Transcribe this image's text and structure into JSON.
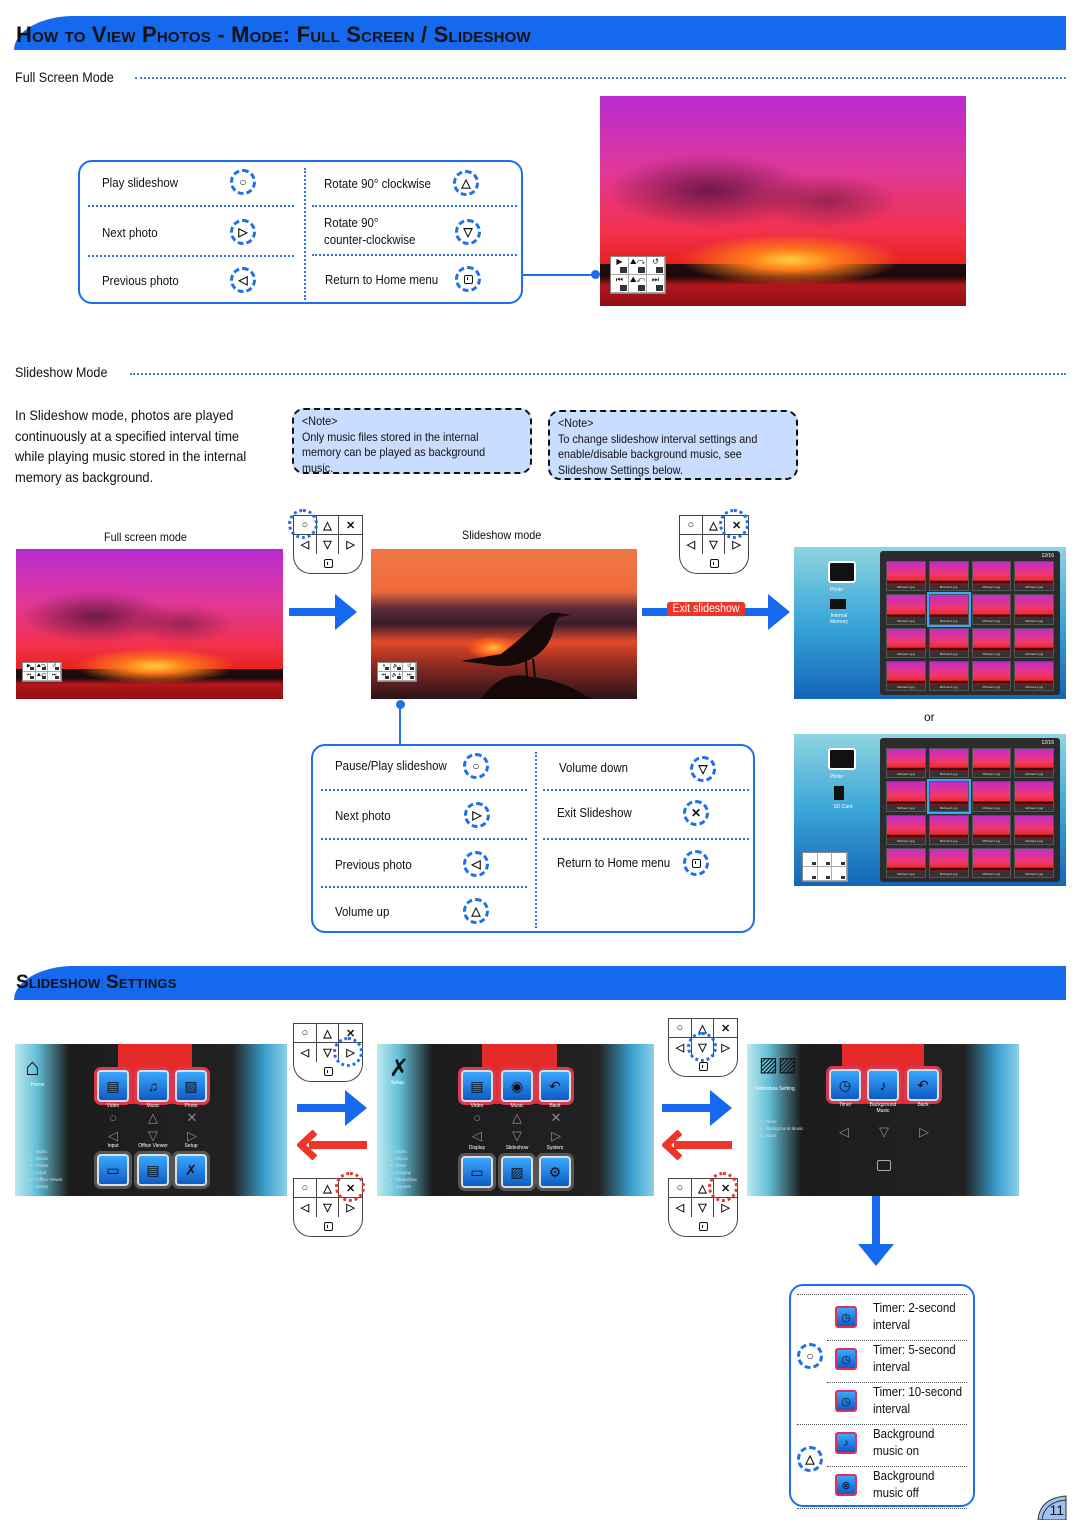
{
  "page": {
    "title": "How to View Photos - Mode: Full Screen / Slideshow",
    "page_number": "11",
    "colors": {
      "brand_blue": "#1469ef",
      "note_bg": "#c9ddff",
      "exit_red": "#ee3528"
    }
  },
  "full_screen": {
    "section_label": "Full Screen Mode",
    "legend": {
      "left": [
        {
          "label": "Play slideshow",
          "key": "○",
          "icon": "circle-key-icon"
        },
        {
          "label": "Next photo",
          "key": "▷",
          "icon": "right-key-icon"
        },
        {
          "label": "Previous photo",
          "key": "◁",
          "icon": "left-key-icon"
        }
      ],
      "right": [
        {
          "label": "Rotate 90° clockwise",
          "key": "△",
          "icon": "up-key-icon"
        },
        {
          "label_line1": "Rotate 90°",
          "label_line2": "counter-clockwise",
          "key": "▽",
          "icon": "down-key-icon"
        },
        {
          "label": "Return to Home menu",
          "key": "home",
          "icon": "home-key-icon"
        }
      ]
    },
    "osd": [
      "▶",
      "⛰↷",
      "↺",
      "⏮",
      "⛰↶",
      "⏭"
    ]
  },
  "slideshow": {
    "section_label": "Slideshow Mode",
    "intro": [
      "In Slideshow mode, photos are played",
      "continuously at a specified interval time",
      "while playing music stored in the internal",
      "memory as background."
    ],
    "notes": [
      {
        "title": "<Note>",
        "lines": [
          "Only music files stored in the internal",
          "memory can be played as background",
          " music."
        ]
      },
      {
        "title": "<Note>",
        "lines": [
          "To change slideshow interval settings and",
          "enable/disable background music, see",
          "Slideshow Settings below."
        ]
      }
    ],
    "caption_full": "Full screen mode",
    "caption_slideshow": "Slideshow mode",
    "exit_badge": "Exit slideshow",
    "or_label": "or",
    "pad_keys": [
      "○",
      "△",
      "✕",
      "◁",
      "▽",
      "▷"
    ],
    "osd": [
      "⏸",
      "🔈-",
      "↺",
      "⏮",
      "🔈+",
      "⏭"
    ],
    "browser1": {
      "left_label": "Photo",
      "source_label": "Internal Memory",
      "counter": "12/16",
      "file": "Michael-1.jpg"
    },
    "browser2": {
      "left_label": "Photo",
      "source_label": "SD Card",
      "counter": "12/16",
      "file": "Michael-1.jpg"
    },
    "legend": {
      "left": [
        {
          "label": "Pause/Play slideshow",
          "key": "○"
        },
        {
          "label": "Next photo",
          "key": "▷"
        },
        {
          "label": "Previous photo",
          "key": "◁"
        },
        {
          "label": "Volume up",
          "key": "△"
        }
      ],
      "right": [
        {
          "label": "Volume down",
          "key": "▽"
        },
        {
          "label": "Exit Slideshow",
          "key": "✕"
        },
        {
          "label": "Return to Home menu",
          "key": "home"
        }
      ]
    }
  },
  "settings": {
    "title": "Slideshow Settings",
    "home_screen": {
      "title": "Home",
      "tiles_top": [
        "Video",
        "Music",
        "Photo"
      ],
      "tiles_bottom": [
        "Input",
        "Office Viewer",
        "Setup"
      ],
      "key_list": [
        "○ : Video",
        "△ : Music",
        "✕ : Photo",
        "◁ : Input",
        "▽ : Office Viewer",
        "▷ : Setup"
      ]
    },
    "setup_screen": {
      "title": "Setup",
      "tiles_top": [
        "Video",
        "Music",
        "Back"
      ],
      "tiles_bottom": [
        "Display",
        "Slideshow",
        "System"
      ],
      "key_list": [
        "○ : Video",
        "△ : Music",
        "✕ : Back",
        "◁ : Display",
        "▽ : Slideshow",
        "▷ : System"
      ]
    },
    "slideshow_screen": {
      "title": "Slideshow Setting",
      "tiles_top": [
        "Timer",
        "Background Music",
        "Back"
      ],
      "key_list": [
        "○ : Timer",
        "△ : Background Music",
        "✕ : Back"
      ]
    },
    "options": [
      {
        "label_line1": "Timer: 2-second",
        "label_line2": "interval",
        "group": "timer"
      },
      {
        "label_line1": "Timer: 5-second",
        "label_line2": "interval",
        "group": "timer"
      },
      {
        "label_line1": "Timer: 10-second",
        "label_line2": "interval",
        "group": "timer"
      },
      {
        "label_line1": "Background",
        "label_line2": "music on",
        "group": "music"
      },
      {
        "label_line1": "Background",
        "label_line2": "music off",
        "group": "music"
      }
    ],
    "option_keys": {
      "timer": "○",
      "music": "△"
    }
  }
}
